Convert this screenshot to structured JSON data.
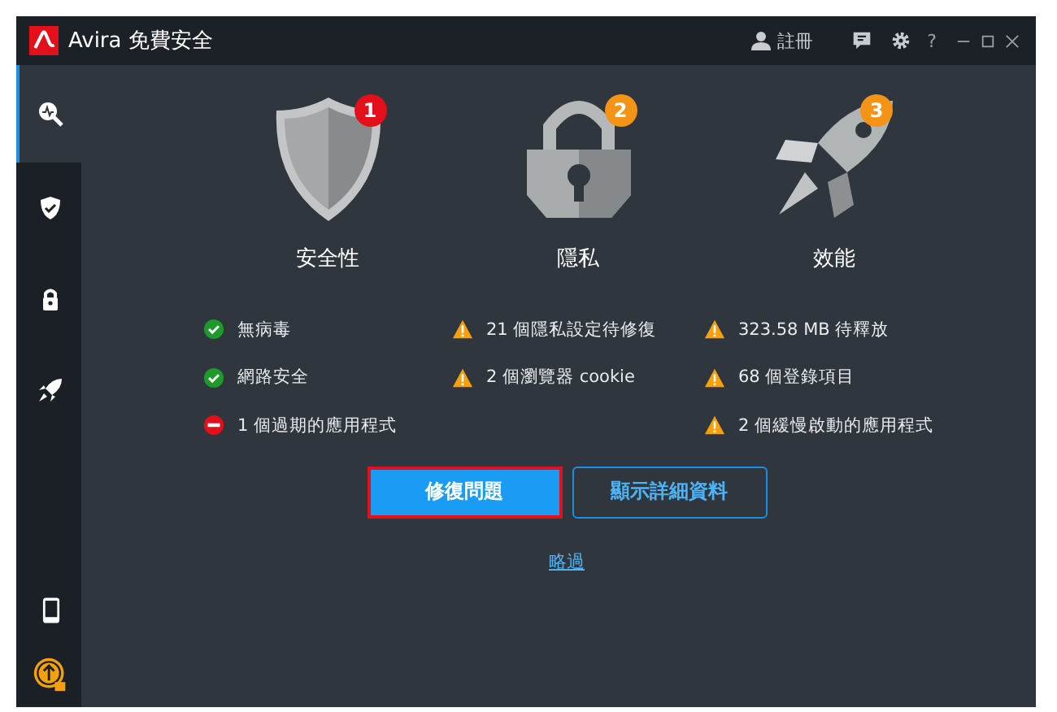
{
  "window": {
    "title": "Avira 免費安全",
    "register": "註冊",
    "help": "?"
  },
  "sidebar": {
    "items": [
      {
        "kind": "scan",
        "selected": true
      },
      {
        "kind": "shield",
        "selected": false
      },
      {
        "kind": "lock",
        "selected": false
      },
      {
        "kind": "rocket",
        "selected": false
      }
    ],
    "bottom_items": [
      {
        "kind": "phone"
      },
      {
        "kind": "upgrade"
      }
    ]
  },
  "categories": [
    {
      "kind": "shield",
      "title": "安全性",
      "badge": "1",
      "color": "#e30f1b",
      "items": [
        {
          "kind": "ok",
          "text": "無病毒"
        },
        {
          "kind": "ok",
          "text": "網路安全"
        },
        {
          "kind": "error",
          "text": "1 個過期的應用程式"
        }
      ]
    },
    {
      "kind": "lock",
      "title": "隱私",
      "badge": "2",
      "color": "#f39416",
      "items": [
        {
          "kind": "warning",
          "text": "21 個隱私設定待修復"
        },
        {
          "kind": "warning",
          "text": "2 個瀏覽器 cookie"
        }
      ]
    },
    {
      "kind": "rocket",
      "title": "效能",
      "badge": "3",
      "color": "#f39416",
      "items": [
        {
          "kind": "warning",
          "text": "323.58 MB 待釋放"
        },
        {
          "kind": "warning",
          "text": "68 個登錄項目"
        },
        {
          "kind": "warning",
          "text": "2 個緩慢啟動的應用程式"
        }
      ]
    }
  ],
  "buttons": [
    {
      "kind": "primary",
      "label": "修復問題"
    },
    {
      "kind": "secondary",
      "label": "顯示詳細資料"
    }
  ],
  "skip_link": "略過"
}
